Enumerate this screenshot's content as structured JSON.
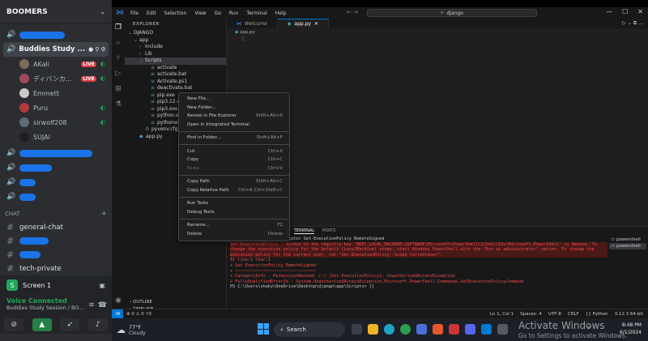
{
  "discord": {
    "server_name": "BOOMERS",
    "active_channel": "Buddies Study ...",
    "members": [
      {
        "name": "AKali",
        "live": "LIVE",
        "color": "#7a6d5a"
      },
      {
        "name": "ディバンカ...",
        "live": "LIVE",
        "color": "#9e4a5c"
      },
      {
        "name": "Emmett",
        "live": "",
        "color": "#c9c9c9"
      },
      {
        "name": "Puru",
        "live": "",
        "color": "#b33939"
      },
      {
        "name": "sirwolf208",
        "live": "",
        "color": "#5f6b78"
      },
      {
        "name": "SUJAI",
        "live": "",
        "color": "#1f1f1f"
      }
    ],
    "chat_category": "CHAT",
    "text_channels": [
      "general-chat",
      "tech-private"
    ],
    "screen_label": "Screen 1",
    "voice_status": "Voice Connected",
    "voice_sub": "Buddies Study Session / BO..."
  },
  "vscode": {
    "menus": [
      "File",
      "Edit",
      "Selection",
      "View",
      "Go",
      "Run",
      "Terminal",
      "Help"
    ],
    "search": "django",
    "explorer_title": "EXPLORER",
    "tree": [
      {
        "label": "DJANGO",
        "indent": 0,
        "twisty": "⌄",
        "icon": ""
      },
      {
        "label": "app",
        "indent": 1,
        "twisty": "⌄",
        "icon": ""
      },
      {
        "label": "Include",
        "indent": 2,
        "twisty": "›",
        "icon": ""
      },
      {
        "label": "Lib",
        "indent": 2,
        "twisty": "›",
        "icon": ""
      },
      {
        "label": "Scripts",
        "indent": 2,
        "twisty": "⌄",
        "icon": "",
        "selected": true
      },
      {
        "label": "activate",
        "indent": 3,
        "twisty": "",
        "icon": "≡"
      },
      {
        "label": "activate.bat",
        "indent": 3,
        "twisty": "",
        "icon": "≡"
      },
      {
        "label": "Activate.ps1",
        "indent": 3,
        "twisty": "",
        "icon": "≡"
      },
      {
        "label": "deactivate.bat",
        "indent": 3,
        "twisty": "",
        "icon": "≡"
      },
      {
        "label": "pip.exe",
        "indent": 3,
        "twisty": "",
        "icon": "≡"
      },
      {
        "label": "pip3.12.exe",
        "indent": 3,
        "twisty": "",
        "icon": "≡"
      },
      {
        "label": "pip3.exe",
        "indent": 3,
        "twisty": "",
        "icon": "≡"
      },
      {
        "label": "python.exe",
        "indent": 3,
        "twisty": "",
        "icon": "≡"
      },
      {
        "label": "pythonw.exe",
        "indent": 3,
        "twisty": "",
        "icon": "≡"
      },
      {
        "label": "pyvenv.cfg",
        "indent": 2,
        "twisty": "",
        "icon": "⚙"
      },
      {
        "label": "app.py",
        "indent": 1,
        "twisty": "",
        "icon": "◆"
      }
    ],
    "outline": "OUTLINE",
    "timeline": "TIMELINE",
    "tabs": [
      {
        "label": "Welcome",
        "active": false
      },
      {
        "label": "app.py",
        "active": true
      }
    ],
    "breadcrumb": "app.py",
    "line_number": "1",
    "panel_tabs": [
      "ONSOLE",
      "TERMINAL",
      "PORTS"
    ],
    "terminal_lines": [
      {
        "text": "\\Desktop\\django\\app\\Scripts> Set-ExecutionPolicy RemoteSigned",
        "cls": ""
      },
      {
        "text": "Set-ExecutionPolicy : Access to the registry key 'HKEY_LOCAL_MACHINE\\SOFTWARE\\Microsoft\\PowerShell\\1\\ShellIds\\Microsoft.PowerShell' is denied. To",
        "cls": "terr"
      },
      {
        "text": "change the execution policy for the default (LocalMachine) scope, start Windows PowerShell with the \"Run as administrator\" option. To change the",
        "cls": "terr"
      },
      {
        "text": "execution policy for the current user, run \"Set-ExecutionPolicy -Scope CurrentUser\".",
        "cls": "terr"
      },
      {
        "text": "At line:1 char:1",
        "cls": "tpink"
      },
      {
        "text": "+ Set-ExecutionPolicy RemoteSigned",
        "cls": "tpink"
      },
      {
        "text": "+ ~~~~~~~~~~~~~~~~~~~~~~~~~~~~~~~~",
        "cls": "tpink"
      },
      {
        "text": "    + CategoryInfo          : PermissionDenied: (:) [Set-ExecutionPolicy], UnauthorizedAccessException",
        "cls": "tpink"
      },
      {
        "text": "    + FullyQualifiedErrorId : System.UnauthorizedAccessException,Microsoft.PowerShell.Commands.SetExecutionPolicyCommand",
        "cls": "tpink"
      },
      {
        "text": "PS C:\\Users\\shaky\\OneDrive\\Desktop\\django\\app\\Scripts> []",
        "cls": ""
      }
    ],
    "terminal_list": [
      "powershell",
      "powershell"
    ],
    "status_left": "⊗ 0 ⚠ 0   ⚡0",
    "status_right": [
      "Ln 1, Col 1",
      "Spaces: 4",
      "UTF-8",
      "CRLF",
      "{} Python",
      "3.12.3 64-bit"
    ]
  },
  "context_menu": [
    {
      "label": "New File...",
      "shortcut": ""
    },
    {
      "label": "New Folder...",
      "shortcut": ""
    },
    {
      "label": "Reveal in File Explorer",
      "shortcut": "Shift+Alt+R"
    },
    {
      "label": "Open in Integrated Terminal",
      "shortcut": ""
    },
    {
      "sep": true
    },
    {
      "label": "Find in Folder...",
      "shortcut": "Shift+Alt+F"
    },
    {
      "sep": true
    },
    {
      "label": "Cut",
      "shortcut": "Ctrl+X"
    },
    {
      "label": "Copy",
      "shortcut": "Ctrl+C"
    },
    {
      "label": "Paste",
      "shortcut": "Ctrl+V",
      "disabled": true
    },
    {
      "sep": true
    },
    {
      "label": "Copy Path",
      "shortcut": "Shift+Alt+C"
    },
    {
      "label": "Copy Relative Path",
      "shortcut": "Ctrl+K Ctrl+Shift+C"
    },
    {
      "sep": true
    },
    {
      "label": "Run Tests",
      "shortcut": ""
    },
    {
      "label": "Debug Tests",
      "shortcut": ""
    },
    {
      "sep": true
    },
    {
      "label": "Rename...",
      "shortcut": "F2"
    },
    {
      "label": "Delete",
      "shortcut": "Delete"
    }
  ],
  "taskbar": {
    "weather_temp": "77°F",
    "weather_desc": "Cloudy",
    "search": "Search",
    "time": "8:48 PM",
    "date": "6/1/2024"
  },
  "watermark": {
    "title": "Activate Windows",
    "sub": "Go to Settings to activate Windows."
  }
}
